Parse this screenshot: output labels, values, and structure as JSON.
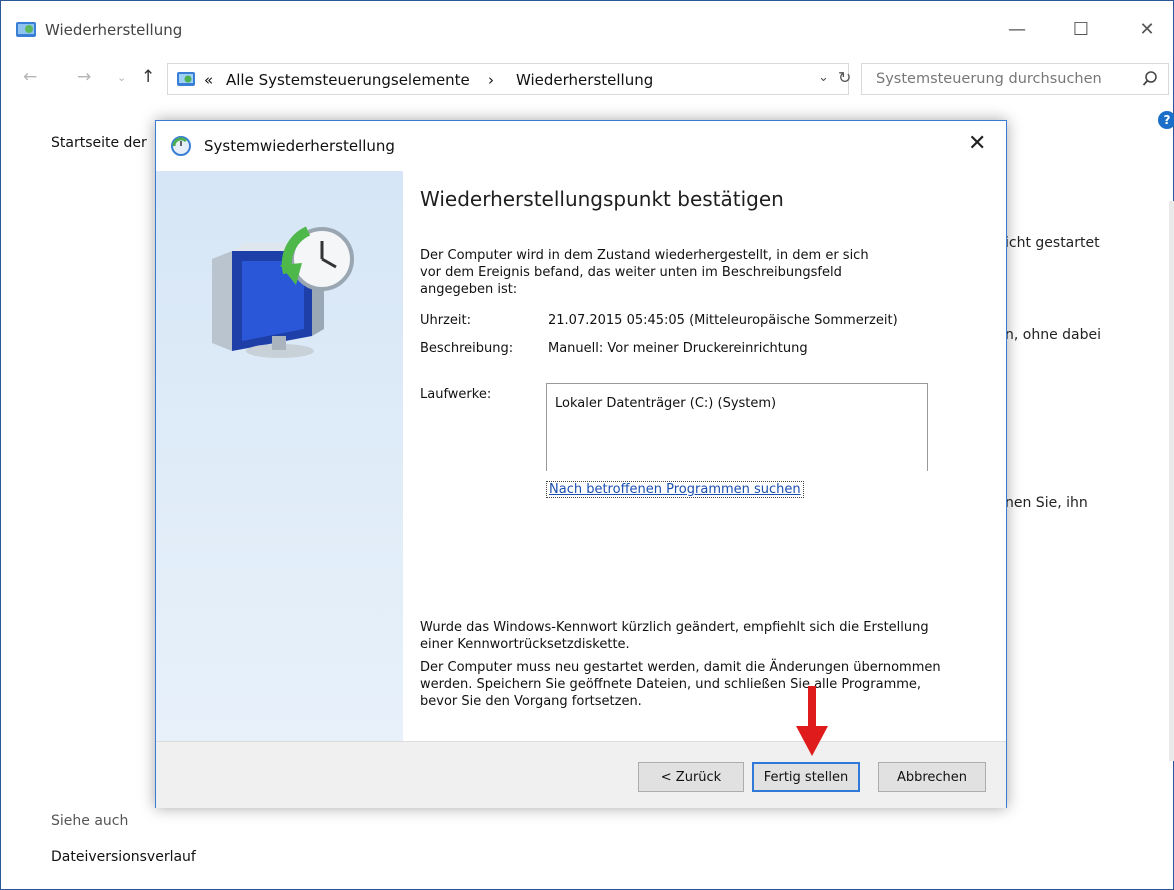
{
  "window": {
    "title": "Wiederherstellung",
    "controls": {
      "minimize": "—",
      "maximize": "☐",
      "close": "✕"
    }
  },
  "addressbar": {
    "chevrons": "«",
    "crumb1": "Alle Systemsteuerungselemente",
    "separator": "›",
    "crumb2": "Wiederherstellung",
    "search_placeholder": "Systemsteuerung durchsuchen"
  },
  "sidebar": {
    "home_label": "Startseite der"
  },
  "background_panel": {
    "text1": "icht gestartet",
    "text2": "n, ohne dabei",
    "text3": "nen Sie, ihn"
  },
  "see_also": {
    "heading": "Siehe auch",
    "file_history": "Dateiversionsverlauf"
  },
  "dialog": {
    "title": "Systemwiederherstellung",
    "close": "✕",
    "heading": "Wiederherstellungspunkt bestätigen",
    "intro": "Der Computer wird in dem Zustand wiederhergestellt, in dem er sich vor dem Ereignis befand, das weiter unten im Beschreibungsfeld angegeben ist:",
    "time_label": "Uhrzeit:",
    "time_value": "21.07.2015 05:45:05 (Mitteleuropäische Sommerzeit)",
    "desc_label": "Beschreibung:",
    "desc_value": "Manuell: Vor meiner Druckereinrichtung",
    "drives_label": "Laufwerke:",
    "drives": [
      "Lokaler Datenträger (C:) (System)"
    ],
    "scan_link": "Nach betroffenen Programmen suchen",
    "note_password": "Wurde das Windows-Kennwort kürzlich geändert, empfiehlt sich die Erstellung einer Kennwortrücksetzdiskette.",
    "note_restart": "Der Computer muss neu gestartet werden, damit die Änderungen übernommen werden. Speichern Sie geöffnete Dateien, und schließen Sie alle Programme, bevor Sie den Vorgang fortsetzen.",
    "buttons": {
      "back": "< Zurück",
      "finish": "Fertig stellen",
      "cancel": "Abbrechen"
    }
  },
  "colors": {
    "accent": "#3079d8",
    "annotation_arrow": "#e01b1b"
  }
}
